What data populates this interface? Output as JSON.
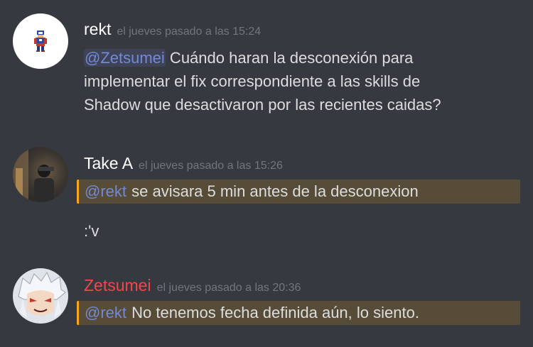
{
  "messages": [
    {
      "author": "rekt",
      "author_color": "#ffffff",
      "timestamp": "el jueves pasado a las 15:24",
      "mention": "@Zetsumei",
      "text_lines": [
        " Cuándo haran la desconexión para",
        "implementar el fix correspondiente a las skills de",
        "Shadow que desactivaron por las recientes caidas?"
      ]
    },
    {
      "author": "Take A",
      "author_color": "#ffffff",
      "timestamp": "el jueves pasado a las 15:26",
      "mention": "@rekt",
      "text": " se avisara 5 min antes de la desconexion",
      "followup": ":'v"
    },
    {
      "author": "Zetsumei",
      "author_color": "#f04747",
      "timestamp": "el jueves pasado a las 20:36",
      "mention": "@rekt",
      "text": " No tenemos fecha definida aún, lo siento."
    }
  ],
  "colors": {
    "background": "#36393f",
    "mention": "#7289da",
    "highlight_bg": "#574c37",
    "highlight_border": "#faa61a",
    "timestamp": "#72767d"
  }
}
